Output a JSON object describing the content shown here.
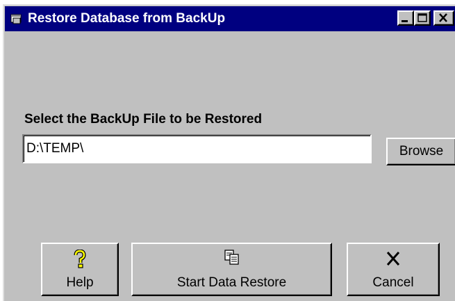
{
  "window": {
    "title": "Restore Database from BackUp",
    "icon": "database-app-icon",
    "caption_buttons": [
      "minimize-icon",
      "maximize-icon",
      "close-icon"
    ]
  },
  "form": {
    "select_label": "Select the BackUp File to be Restored",
    "file_path_value": "D:\\TEMP\\",
    "browse_label": "Browse"
  },
  "actions": {
    "help": {
      "label": "Help",
      "icon": "question-mark-icon"
    },
    "start": {
      "label": "Start Data Restore",
      "icon": "copy-documents-icon"
    },
    "cancel": {
      "label": "Cancel",
      "icon": "x-cancel-icon"
    }
  },
  "colors": {
    "titlebar": "#000080",
    "face": "#c0c0c0",
    "help_icon": "#ffff00"
  }
}
